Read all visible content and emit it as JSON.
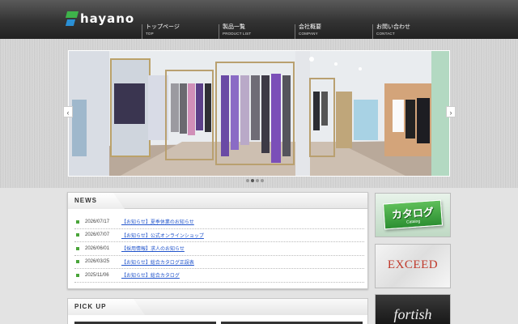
{
  "header": {
    "logo_text": "hayano",
    "nav": [
      {
        "jp": "トップページ",
        "en": "TOP"
      },
      {
        "jp": "製品一覧",
        "en": "PRODUCT LIST"
      },
      {
        "jp": "会社概要",
        "en": "COMPANY"
      },
      {
        "jp": "お問い合わせ",
        "en": "CONTACT"
      }
    ]
  },
  "slider": {
    "prev_label": "‹",
    "next_label": "›",
    "dot_count": 4,
    "active_dot": 1
  },
  "news": {
    "title": "NEWS",
    "items": [
      {
        "date": "2026/07/17",
        "text": "【お知らせ】夏季休業のお知らせ"
      },
      {
        "date": "2026/07/07",
        "text": "【お知らせ】公式オンラインショップ"
      },
      {
        "date": "2026/06/01",
        "text": "【採用情報】求人のお知らせ"
      },
      {
        "date": "2026/03/25",
        "text": "【お知らせ】総合カタログ正誤表"
      },
      {
        "date": "2025/11/06",
        "text": "【お知らせ】総合カタログ"
      }
    ]
  },
  "pickup": {
    "title": "PICK UP"
  },
  "banners": {
    "catalog": {
      "title": "カタログ",
      "sub": "Catalog"
    },
    "exceed": {
      "title": "EXCEED"
    },
    "fortish": {
      "title": "fortish"
    }
  },
  "colors": {
    "accent_green": "#4aa53a",
    "link_blue": "#2255cc",
    "exceed_red": "#c0392b"
  }
}
